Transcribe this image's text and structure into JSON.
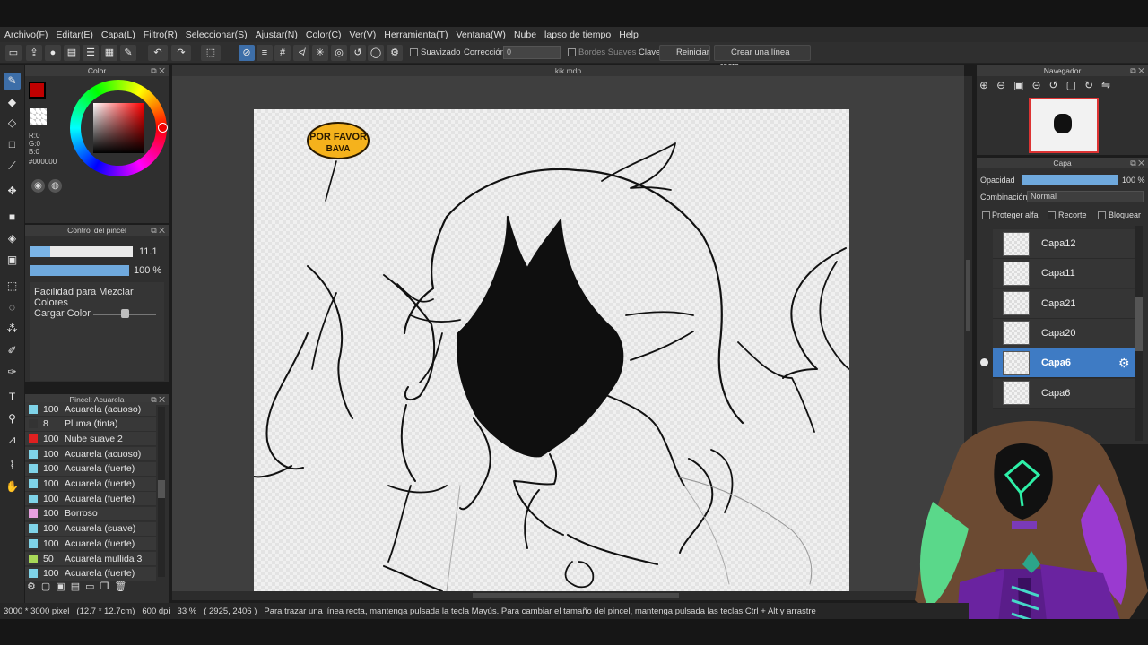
{
  "menu": [
    "Archivo(F)",
    "Editar(E)",
    "Capa(L)",
    "Filtro(R)",
    "Seleccionar(S)",
    "Ajustar(N)",
    "Color(C)",
    "Ver(V)",
    "Herramienta(T)",
    "Ventana(W)",
    "Nube",
    "lapso de tiempo",
    "Help"
  ],
  "toolbar": {
    "suavizado_label": "Suavizado",
    "correccion_label": "Corrección",
    "correccion_value": "0",
    "bordes_label": "Bordes Suaves",
    "clave_label": "Clave",
    "reiniciar_label": "Reiniciar",
    "linea_recta_label": "Crear una línea recta"
  },
  "document": {
    "tab_title": "kik.mdp"
  },
  "color_panel": {
    "title": "Color",
    "primary_color": "#c00000",
    "r": "R:0",
    "g": "G:0",
    "b": "B:0",
    "hex": "#000000"
  },
  "brush_control": {
    "title": "Control del pincel",
    "size_value": "11.1",
    "opacity_value": "100 %",
    "mix_label": "Facilidad para Mezclar Colores",
    "load_label": "Cargar Color"
  },
  "brush_list": {
    "title": "Pincel: Acuarela",
    "items": [
      {
        "size": "100",
        "name": "Acuarela (acuoso)",
        "color": "#7fd3e8"
      },
      {
        "size": "8",
        "name": "Pluma (tinta)",
        "color": "#333333"
      },
      {
        "size": "100",
        "name": "Nube suave 2",
        "color": "#e02020"
      },
      {
        "size": "100",
        "name": "Acuarela (acuoso)",
        "color": "#7fd3e8"
      },
      {
        "size": "100",
        "name": "Acuarela (fuerte)",
        "color": "#7fd3e8"
      },
      {
        "size": "100",
        "name": "Acuarela (fuerte)",
        "color": "#7fd3e8"
      },
      {
        "size": "100",
        "name": "Acuarela (fuerte)",
        "color": "#7fd3e8"
      },
      {
        "size": "100",
        "name": "Borroso",
        "color": "#e8a0e0"
      },
      {
        "size": "100",
        "name": "Acuarela (suave)",
        "color": "#7fd3e8"
      },
      {
        "size": "100",
        "name": "Acuarela (fuerte)",
        "color": "#7fd3e8"
      },
      {
        "size": "50",
        "name": "Acuarela mullida 3",
        "color": "#a8d858"
      },
      {
        "size": "100",
        "name": "Acuarela (fuerte)",
        "color": "#7fd3e8"
      }
    ]
  },
  "navigator": {
    "title": "Navegador"
  },
  "layer_panel": {
    "title": "Capa",
    "opacity_label": "Opacidad",
    "opacity_value": "100 %",
    "blend_label": "Combinación",
    "blend_value": "Normal",
    "protect_alpha": "Proteger alfa",
    "clip": "Recorte",
    "lock": "Bloquear",
    "layers": [
      "Capa12",
      "Capa11",
      "Capa21",
      "Capa20",
      "Capa6",
      "Capa6"
    ],
    "selected_index": 4
  },
  "canvas": {
    "speech_bubble_text_1": "POR FAVOR",
    "speech_bubble_text_2": "BAVA"
  },
  "status": {
    "dimensions": "3000 * 3000 pixel",
    "size_cm": "(12.7 * 12.7cm)",
    "dpi": "600 dpi",
    "zoom": "33 %",
    "coords": "( 2925, 2406 )",
    "hint": "Para trazar una línea recta, mantenga pulsada la tecla Mayús. Para cambiar el tamaño del pincel, mantenga pulsada las teclas Ctrl + Alt y arrastre"
  }
}
